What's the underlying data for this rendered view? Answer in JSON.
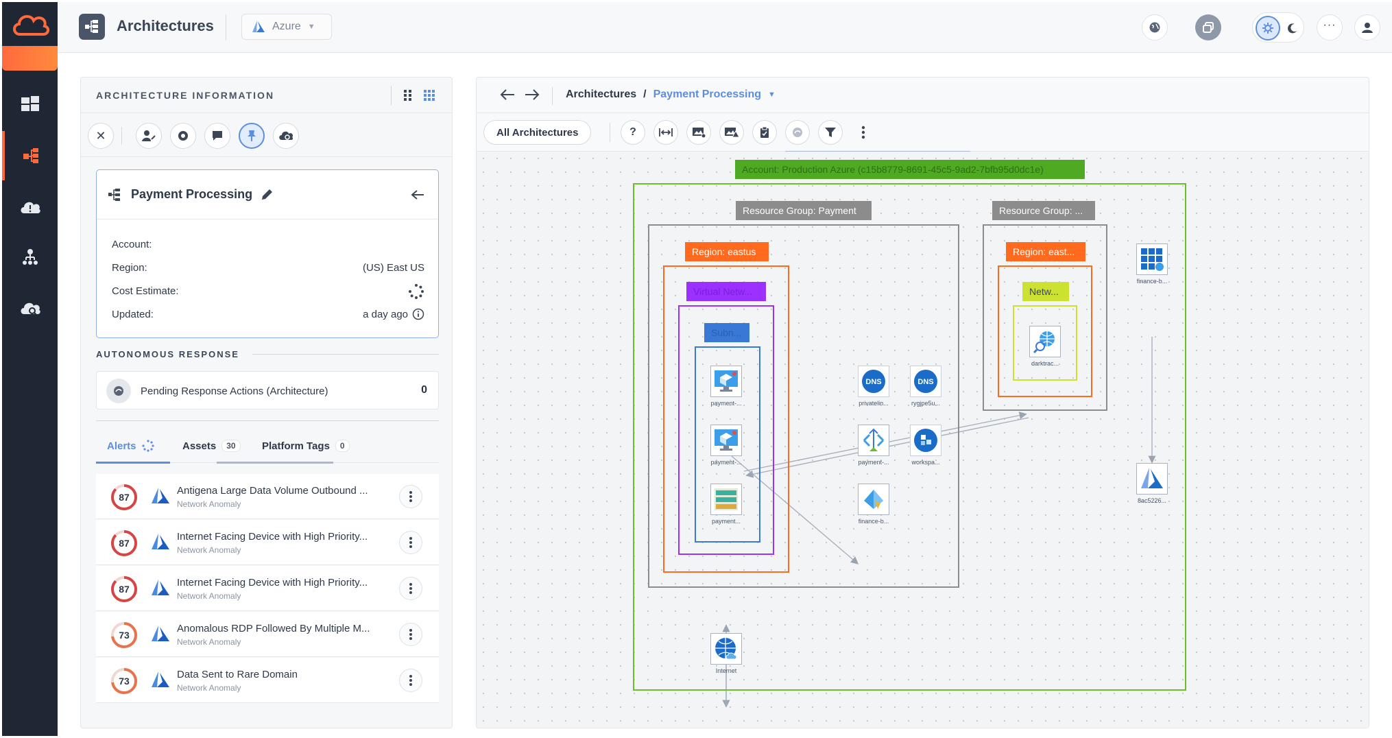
{
  "topbar": {
    "title": "Architectures",
    "cloud_selector": "Azure"
  },
  "left_panel": {
    "header": "ARCHITECTURE INFORMATION",
    "architecture": {
      "name": "Payment Processing",
      "rows": [
        {
          "label": "Account:",
          "value": ""
        },
        {
          "label": "Region:",
          "value": "(US) East US"
        },
        {
          "label": "Cost Estimate:",
          "value": ""
        },
        {
          "label": "Updated:",
          "value": "a day ago"
        }
      ]
    },
    "autonomous_response": {
      "title": "AUTONOMOUS RESPONSE",
      "pending_label": "Pending Response Actions (Architecture)",
      "pending_count": "0"
    },
    "tabs": [
      {
        "label": "Alerts",
        "count": ""
      },
      {
        "label": "Assets",
        "count": "30"
      },
      {
        "label": "Platform Tags",
        "count": "0"
      }
    ],
    "alerts": [
      {
        "score": "87",
        "severity": 0.87,
        "color": "#d64545",
        "title": "Antigena Large Data Volume Outbound ...",
        "type": "Network Anomaly"
      },
      {
        "score": "87",
        "severity": 0.87,
        "color": "#d64545",
        "title": "Internet Facing Device with High Priority...",
        "type": "Network Anomaly"
      },
      {
        "score": "87",
        "severity": 0.87,
        "color": "#d64545",
        "title": "Internet Facing Device with High Priority...",
        "type": "Network Anomaly"
      },
      {
        "score": "73",
        "severity": 0.73,
        "color": "#e8734a",
        "title": "Anomalous RDP Followed By Multiple M...",
        "type": "Network Anomaly"
      },
      {
        "score": "73",
        "severity": 0.73,
        "color": "#e8734a",
        "title": "Data Sent to Rare Domain",
        "type": "Network Anomaly"
      }
    ]
  },
  "right_panel": {
    "breadcrumb_root": "Architectures",
    "breadcrumb_sep": "/",
    "breadcrumb_current": "Payment Processing",
    "all_architectures": "All Architectures",
    "help_label": "?",
    "diagram": {
      "account": "Account: Production Azure (c15b8779-8691-45c5-9ad2-7bfb95d0dc1e)",
      "rg_payment": "Resource Group: Payment",
      "rg_other": "Resource Group: ...",
      "region_eastus": "Region: eastus",
      "region_east": "Region: east...",
      "vnet": "Virtual Netw...",
      "subnet": "Subn...",
      "netw": "Netw...",
      "nodes": {
        "payment_vm1": "payment-...",
        "payment_vm2": "payment-...",
        "payment_storage": "payment...",
        "dns1": "privatelin...",
        "dns2": "rygjpe5u...",
        "payment_lb": "payment-...",
        "workspace": "workspa...",
        "finance_b": "finance-b...",
        "darktrace": "darktrac...",
        "finance_app": "finance-b...",
        "azure_res": "8ac5226...",
        "internet": "Internet"
      },
      "dns_text": "DNS"
    }
  },
  "colors": {
    "accent": "#5c8edc",
    "brand": "#ff6a3d",
    "account_green": "#6cbf2a",
    "region_orange": "#ff6a1f",
    "vnet_purple": "#9b30ff",
    "subnet_blue": "#3a78d6",
    "netw_lime": "#cde130",
    "rg_gray": "#8c8c8c"
  }
}
